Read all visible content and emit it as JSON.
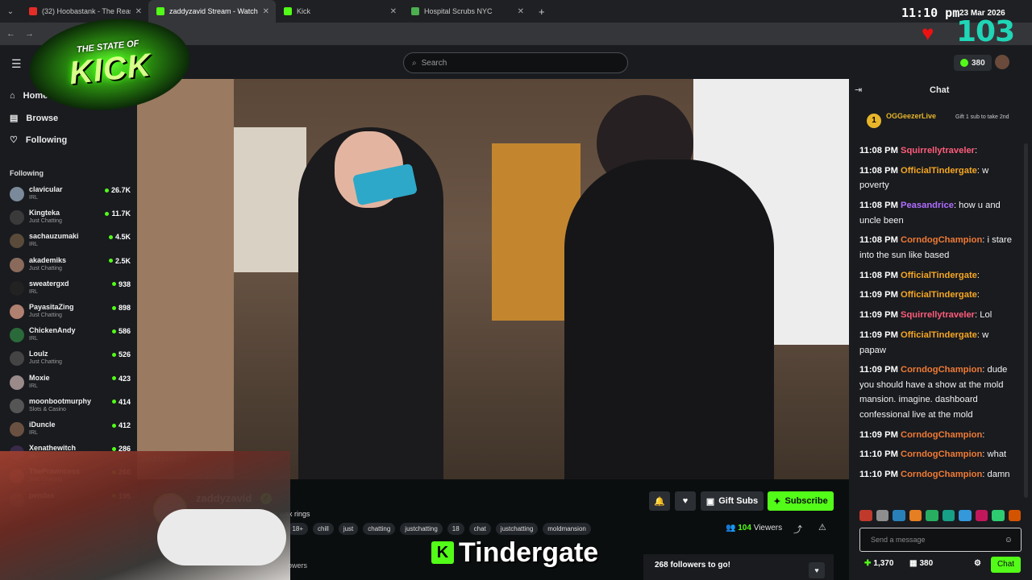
{
  "browser": {
    "tabs": [
      {
        "label": "(32) Hoobastank - The Reason",
        "color": "#e52d27"
      },
      {
        "label": "zaddyzavid Stream - Watch",
        "color": "#53fc18"
      },
      {
        "label": "Kick",
        "color": "#53fc18"
      },
      {
        "label": "Hospital Scrubs NYC",
        "color": "#4caf50"
      }
    ],
    "clock": "11:10 pm",
    "date": "23 Mar 2026",
    "overlay_counter": "103"
  },
  "overlay": {
    "logo_top": "THE STATE OF",
    "logo_main": "KICK",
    "lower_third": "Tindergate"
  },
  "header": {
    "search_placeholder": "Search",
    "points": "380"
  },
  "sidebar": {
    "nav": [
      {
        "label": "Home",
        "icon": "home-icon"
      },
      {
        "label": "Browse",
        "icon": "browse-icon"
      },
      {
        "label": "Following",
        "icon": "heart-icon"
      }
    ],
    "following_heading": "Following",
    "following": [
      {
        "name": "clavicular",
        "category": "IRL",
        "viewers": "26.7K",
        "color": "#7a8a9a"
      },
      {
        "name": "Kingteka",
        "category": "Just Chatting",
        "viewers": "11.7K",
        "color": "#3a3a3a"
      },
      {
        "name": "sachauzumaki",
        "category": "IRL",
        "viewers": "4.5K",
        "color": "#5a4a3a"
      },
      {
        "name": "akademiks",
        "category": "Just Chatting",
        "viewers": "2.5K",
        "color": "#8a6a5a"
      },
      {
        "name": "sweatergxd",
        "category": "IRL",
        "viewers": "938",
        "color": "#222222"
      },
      {
        "name": "PayasitaZing",
        "category": "Just Chatting",
        "viewers": "898",
        "color": "#b08070"
      },
      {
        "name": "ChickenAndy",
        "category": "IRL",
        "viewers": "586",
        "color": "#2a6a3a"
      },
      {
        "name": "Loulz",
        "category": "Just Chatting",
        "viewers": "526",
        "color": "#444444"
      },
      {
        "name": "Moxie",
        "category": "IRL",
        "viewers": "423",
        "color": "#9a8a8a"
      },
      {
        "name": "moonbootmurphy",
        "category": "Slots & Casino",
        "viewers": "414",
        "color": "#555555"
      },
      {
        "name": "iDuncle",
        "category": "IRL",
        "viewers": "412",
        "color": "#6a5040"
      },
      {
        "name": "Xenathewitch",
        "category": "IRL",
        "viewers": "286",
        "color": "#3a2a4a"
      },
      {
        "name": "ThePrawncess",
        "category": "Just Chatting",
        "viewers": "260",
        "color": "#a05050"
      },
      {
        "name": "pendas",
        "category": "",
        "viewers": "195",
        "color": "#4a4a4a"
      }
    ]
  },
  "video": {
    "watermark": "zaddyzavid"
  },
  "channel": {
    "name": "zaddyzavid",
    "title": "i will change wax rings",
    "tags": [
      "sh",
      "18+",
      "chill",
      "just",
      "chatting",
      "justchatting",
      "18",
      "chat",
      "justchatting",
      "moldmansion"
    ],
    "gift_label": "Gift Subs",
    "subscribe_label": "Subscribe",
    "viewers_count": "104",
    "viewers_label": "Viewers",
    "followers_text": "owers",
    "goal_text": "268 followers to go!"
  },
  "chat": {
    "title": "Chat",
    "pinned": {
      "rank": "1",
      "user": "OGGeezerLive",
      "gift_text": "Gift 1 sub to take 2nd"
    },
    "messages": [
      {
        "time": "11:08 PM",
        "user": "Squirrellytraveler",
        "color": "#ff5c7a",
        "text": ""
      },
      {
        "time": "11:08 PM",
        "user": "OfficialTindergate",
        "color": "#f5a623",
        "text": "w poverty"
      },
      {
        "time": "11:08 PM",
        "user": "Peasandrice",
        "color": "#b06dff",
        "text": "how u and uncle been"
      },
      {
        "time": "11:08 PM",
        "user": "CorndogChampion",
        "color": "#f07a35",
        "text": "i stare into the sun like based"
      },
      {
        "time": "11:08 PM",
        "user": "OfficialTindergate",
        "color": "#f5a623",
        "text": ""
      },
      {
        "time": "11:09 PM",
        "user": "OfficialTindergate",
        "color": "#f5a623",
        "text": ""
      },
      {
        "time": "11:09 PM",
        "user": "Squirrellytraveler",
        "color": "#ff5c7a",
        "text": "Lol"
      },
      {
        "time": "11:09 PM",
        "user": "OfficialTindergate",
        "color": "#f5a623",
        "text": "w papaw"
      },
      {
        "time": "11:09 PM",
        "user": "CorndogChampion",
        "color": "#f07a35",
        "text": "dude you should have a show at the mold mansion. imagine. dashboard confessional live at the mold"
      },
      {
        "time": "11:09 PM",
        "user": "CorndogChampion",
        "color": "#f07a35",
        "text": ""
      },
      {
        "time": "11:10 PM",
        "user": "CorndogChampion",
        "color": "#f07a35",
        "text": "what"
      },
      {
        "time": "11:10 PM",
        "user": "CorndogChampion",
        "color": "#f07a35",
        "text": "damn"
      }
    ],
    "input_placeholder": "Send a message",
    "footer_points": "1,370",
    "footer_store": "380",
    "send_label": "Chat"
  },
  "colors": {
    "accent": "#53fc18",
    "bg": "#0b0e0f",
    "panel": "#191b1f"
  }
}
